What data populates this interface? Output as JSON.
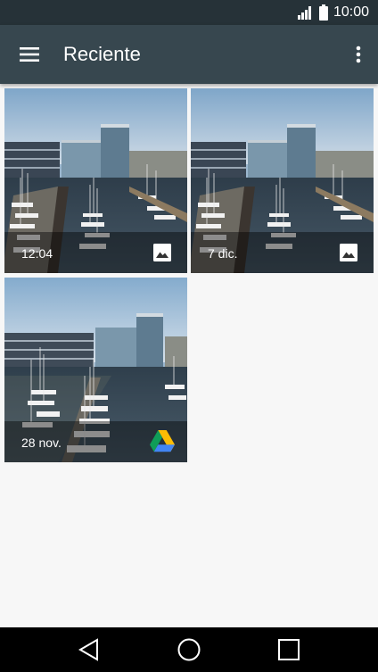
{
  "status_bar": {
    "time": "10:00",
    "icons": [
      "signal-icon",
      "battery-icon"
    ]
  },
  "app_bar": {
    "title": "Reciente",
    "icons": [
      "menu-icon",
      "more-vert-icon"
    ]
  },
  "photos": [
    {
      "label": "12:04",
      "source_icon": "image-icon"
    },
    {
      "label": "7 dic.",
      "source_icon": "image-icon"
    },
    {
      "label": "28 nov.",
      "source_icon": "google-drive-icon"
    }
  ],
  "nav_bar": {
    "icons": [
      "back-icon",
      "home-icon",
      "recents-icon"
    ]
  },
  "colors": {
    "status_bar": "#263238",
    "app_bar": "#37474f",
    "background": "#f7f7f7"
  }
}
